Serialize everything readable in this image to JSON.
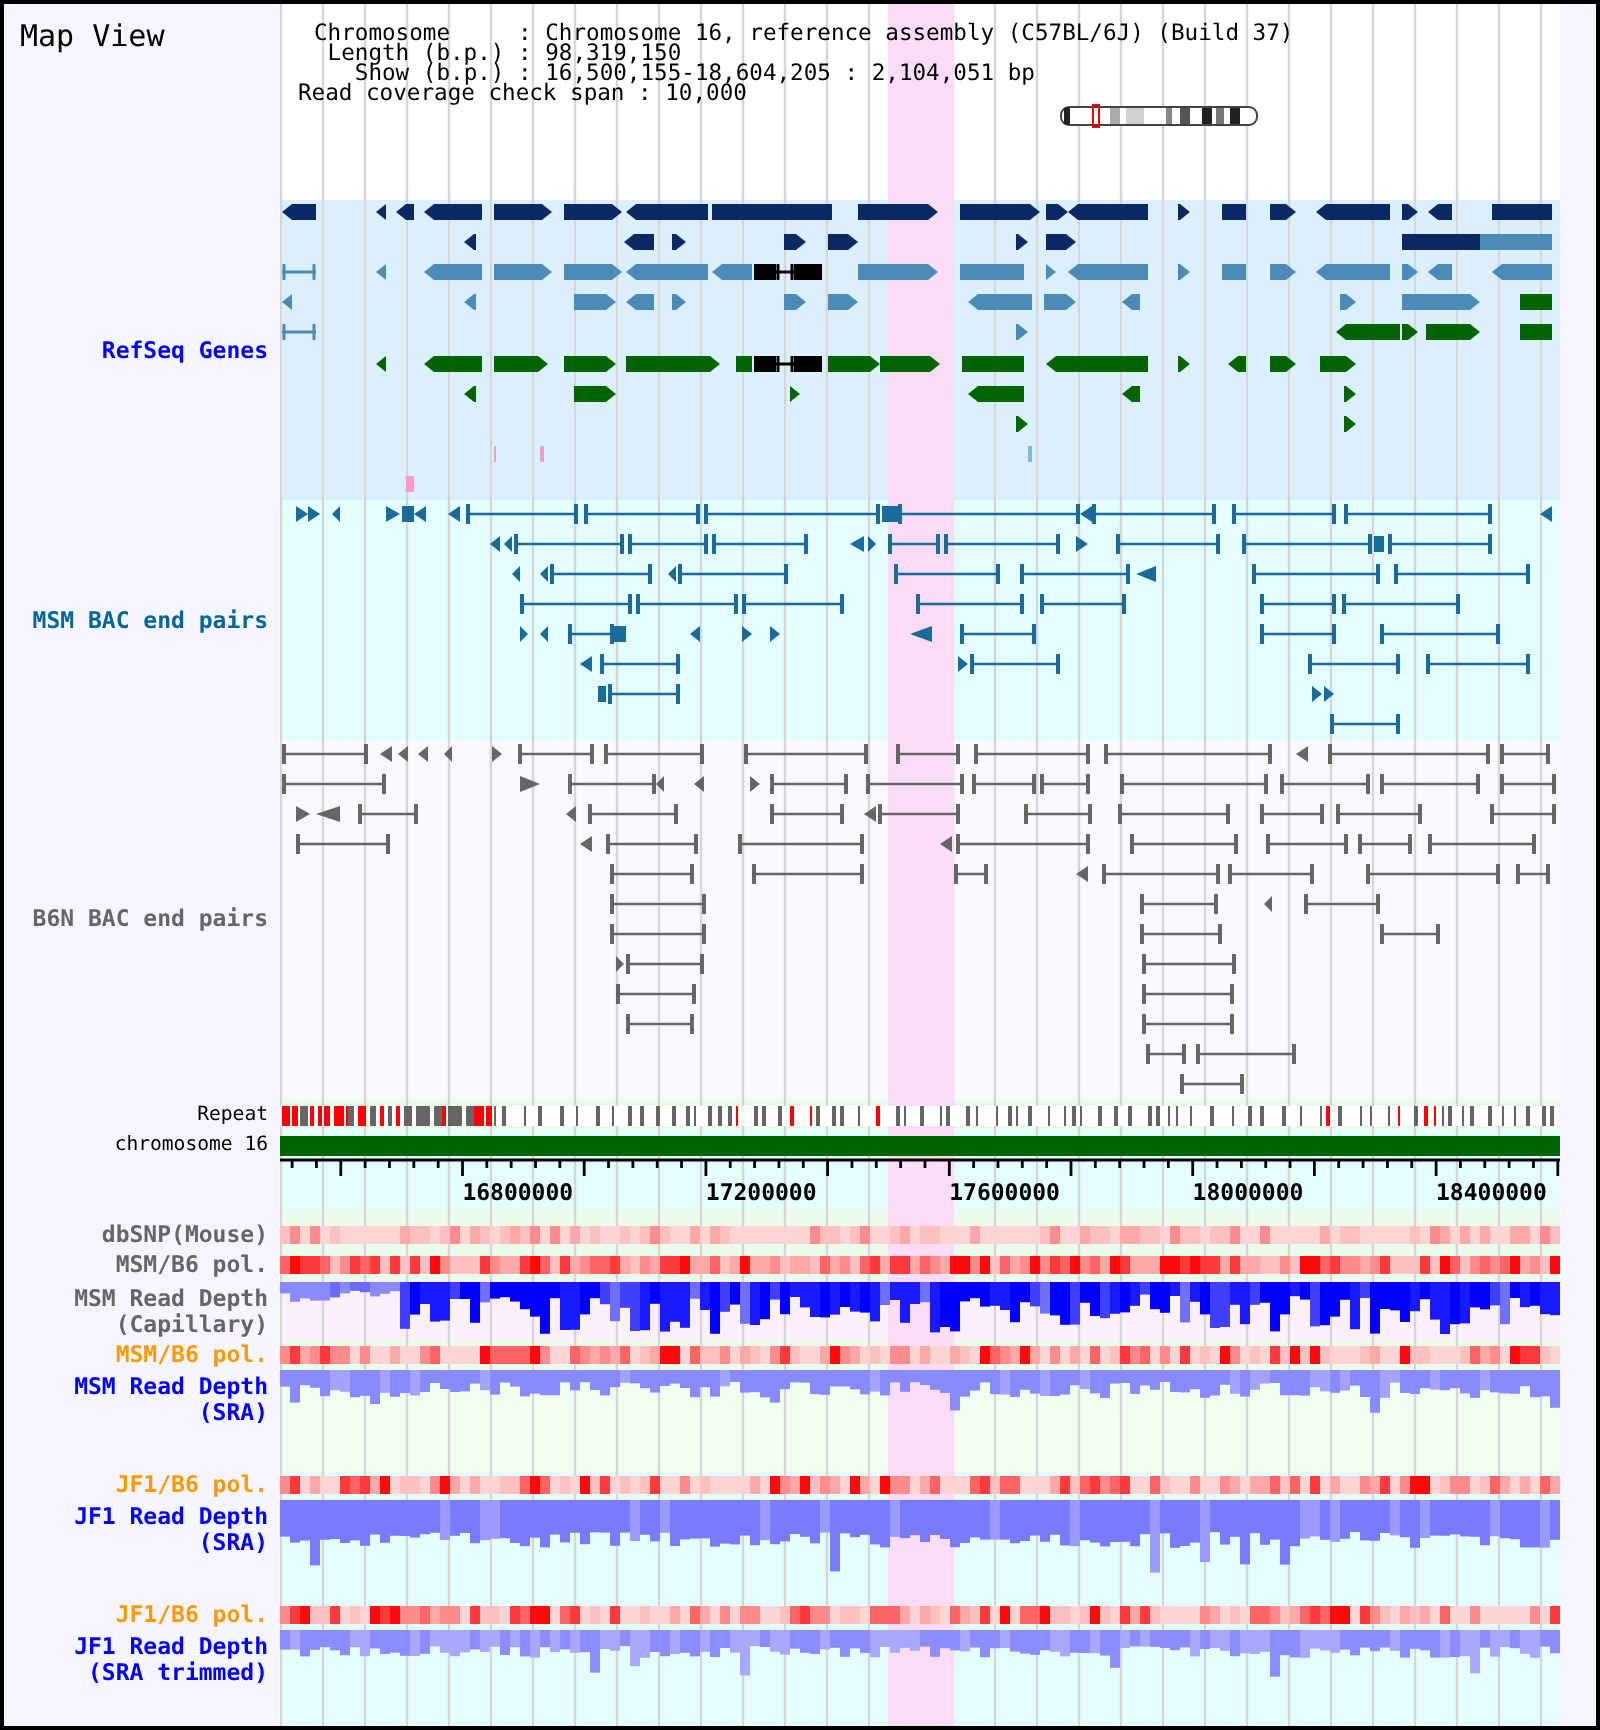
{
  "title": "Map View",
  "info": {
    "rows": [
      {
        "label": "Chromosome     :",
        "value": "Chromosome 16, reference assembly (C57BL/6J) (Build 37)"
      },
      {
        "label": "Length (b.p.) :",
        "value": "98,319,150"
      },
      {
        "label": "Show (b.p.) :",
        "value": "16,500,155-18,604,205 : 2,104,051 bp"
      }
    ],
    "coverage_span": "Read coverage check span : 10,000"
  },
  "tracks": [
    {
      "kind": "genes",
      "label": "RefSeq Genes",
      "color": "#0000ff"
    },
    {
      "kind": "bac_pairs",
      "label": "MSM BAC end pairs",
      "color": "#006699"
    },
    {
      "kind": "bac_pairs",
      "label": "B6N BAC end pairs",
      "color": "#666666"
    },
    {
      "kind": "repeat",
      "label": "Repeat",
      "color": "#000000"
    },
    {
      "kind": "chromosome",
      "label": "chromosome 16",
      "color": "#000000"
    },
    {
      "kind": "axis",
      "tick_labels": [
        "16800000",
        "17200000",
        "17600000",
        "18000000",
        "18400000"
      ]
    },
    {
      "kind": "heatmap",
      "label": "dbSNP(Mouse)",
      "color": "#666666"
    },
    {
      "kind": "heatmap",
      "label": "MSM/B6 pol.",
      "color": "#666666"
    },
    {
      "kind": "depth",
      "label": "MSM Read Depth\n(Capillary)",
      "color": "#666666"
    },
    {
      "kind": "heatmap",
      "label": "MSM/B6 pol.",
      "color": "#ff9900"
    },
    {
      "kind": "depth",
      "label": "MSM Read Depth\n(SRA)",
      "color": "#0000ff"
    },
    {
      "kind": "heatmap",
      "label": "JF1/B6 pol.",
      "color": "#ff9900"
    },
    {
      "kind": "depth",
      "label": "JF1 Read Depth\n(SRA)",
      "color": "#0000ff"
    },
    {
      "kind": "heatmap",
      "label": "JF1/B6 pol.",
      "color": "#ff9900"
    },
    {
      "kind": "depth",
      "label": "JF1 Read Depth\n(SRA trimmed)",
      "color": "#0000ff"
    }
  ]
}
